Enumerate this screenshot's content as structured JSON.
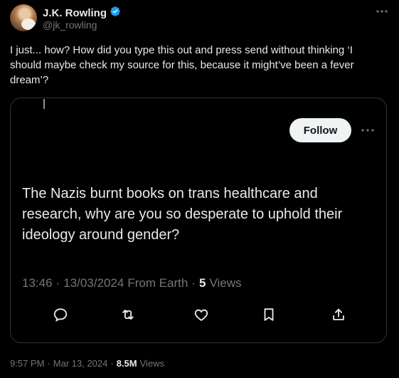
{
  "author": {
    "display_name": "J.K. Rowling",
    "handle": "@jk_rowling",
    "verified_icon": "verified-badge-icon",
    "avatar": "profile-photo"
  },
  "tweet": {
    "text": "I just... how? How did you type this out and press send without thinking ‘I should maybe check my source for this, because it might’ve been a fever dream’?"
  },
  "quoted_card": {
    "follow_label": "Follow",
    "text": "The Nazis burnt books on trans healthcare and research, why are you so desperate to uphold their ideology around gender?",
    "time": "13:46",
    "sep1": "·",
    "date": "13/03/2024",
    "location": "From Earth",
    "sep2": "·",
    "views_count": "5",
    "views_label": "Views",
    "actions": [
      "reply-icon",
      "retweet-icon",
      "like-icon",
      "bookmark-icon",
      "share-icon"
    ]
  },
  "footer": {
    "time": "9:57 PM",
    "sep1": "·",
    "date": "Mar 13, 2024",
    "sep2": "·",
    "views_count": "8.5M",
    "views_label": "Views"
  },
  "colors": {
    "background": "#000000",
    "text": "#e7e9ea",
    "secondary": "#71767b",
    "verified": "#1d9bf0",
    "border": "#2f3336",
    "follow_bg": "#eff3f4"
  }
}
